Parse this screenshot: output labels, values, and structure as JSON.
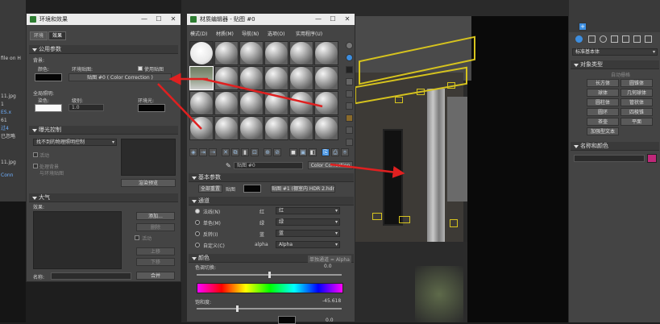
{
  "left_edge": {
    "lines": [
      "file on H",
      "11.jpg",
      "1",
      "ES.x",
      "61",
      "过4",
      "已忽略",
      "11.jpg",
      "Conn",
      "Conn"
    ]
  },
  "env_window": {
    "title": "环境和效果",
    "tabs": [
      "环境",
      "效果"
    ],
    "common_params": {
      "header": "公用参数",
      "background_label": "背景:",
      "color_label": "颜色:",
      "env_map_label": "环境贴图:",
      "use_map_label": "使用贴图",
      "map_button": "贴图 #0 ( Color Correction )"
    },
    "global_lighting": {
      "header": "全局照明:",
      "tint_label": "染色:",
      "level_label": "级别:",
      "level_value": "1.0",
      "ambient_label": "环境光:"
    },
    "exposure": {
      "header": "曝光控制",
      "dropdown": "找不到的物理照明控制",
      "active_label": "活动",
      "process_bg_label": "处理背景",
      "and_env_map_label": "与环境贴图",
      "render_preview_button": "渲染预览"
    },
    "atmosphere": {
      "header": "大气",
      "effects_label": "效果:",
      "add_button": "添加...",
      "delete_button": "删除",
      "active_label": "活动",
      "up_button": "上移",
      "down_button": "下移",
      "name_label": "名称:",
      "merge_button": "合并"
    }
  },
  "mat_window": {
    "title": "材质编辑器 - 贴图 #0",
    "menu": [
      "模式(D)",
      "材质(M)",
      "导航(N)",
      "选项(O)",
      "实用程序(U)"
    ],
    "map_name": "贴图 #0",
    "map_type": "Color Correction",
    "basic_params": {
      "header": "基本参数",
      "default_map_label": "全部重置",
      "map_label": "贴图",
      "map_button": "贴图 #1 (棚室内 HDR 2.hdr)"
    },
    "channels": {
      "header": "通道",
      "rows": [
        {
          "label": "法线(N)",
          "channel": "红",
          "value": "红"
        },
        {
          "label": "单色(M)",
          "channel": "绿",
          "value": "绿"
        },
        {
          "label": "反转(I)",
          "channel": "蓝",
          "value": "蓝"
        },
        {
          "label": "自定义(C)",
          "channel": "alpha",
          "value": "Alpha"
        }
      ]
    },
    "color": {
      "header": "颜色",
      "hue_shift_label": "色调切换:",
      "hue_value": "0.0",
      "saturation_label": "饱和度:",
      "saturation_value": "-45.618",
      "watermark": "单独通道 = Alpha"
    },
    "bottom_value": "0.0"
  },
  "right_panel": {
    "header": "标准基本体",
    "object_type": {
      "header": "对象类型",
      "auto_grid": "自动栅格",
      "buttons": [
        "长方体",
        "圆锥体",
        "球体",
        "几何球体",
        "圆柱体",
        "管状体",
        "圆环",
        "四棱锥",
        "茶壶",
        "平面",
        "加强型文本"
      ]
    },
    "name_color": {
      "header": "名称和颜色"
    }
  },
  "colors": {
    "accent_blue": "#3d8ee0",
    "arrow_red": "#e02020",
    "yellow": "#d6c31e",
    "dark_bg": "#1e1e1e"
  }
}
